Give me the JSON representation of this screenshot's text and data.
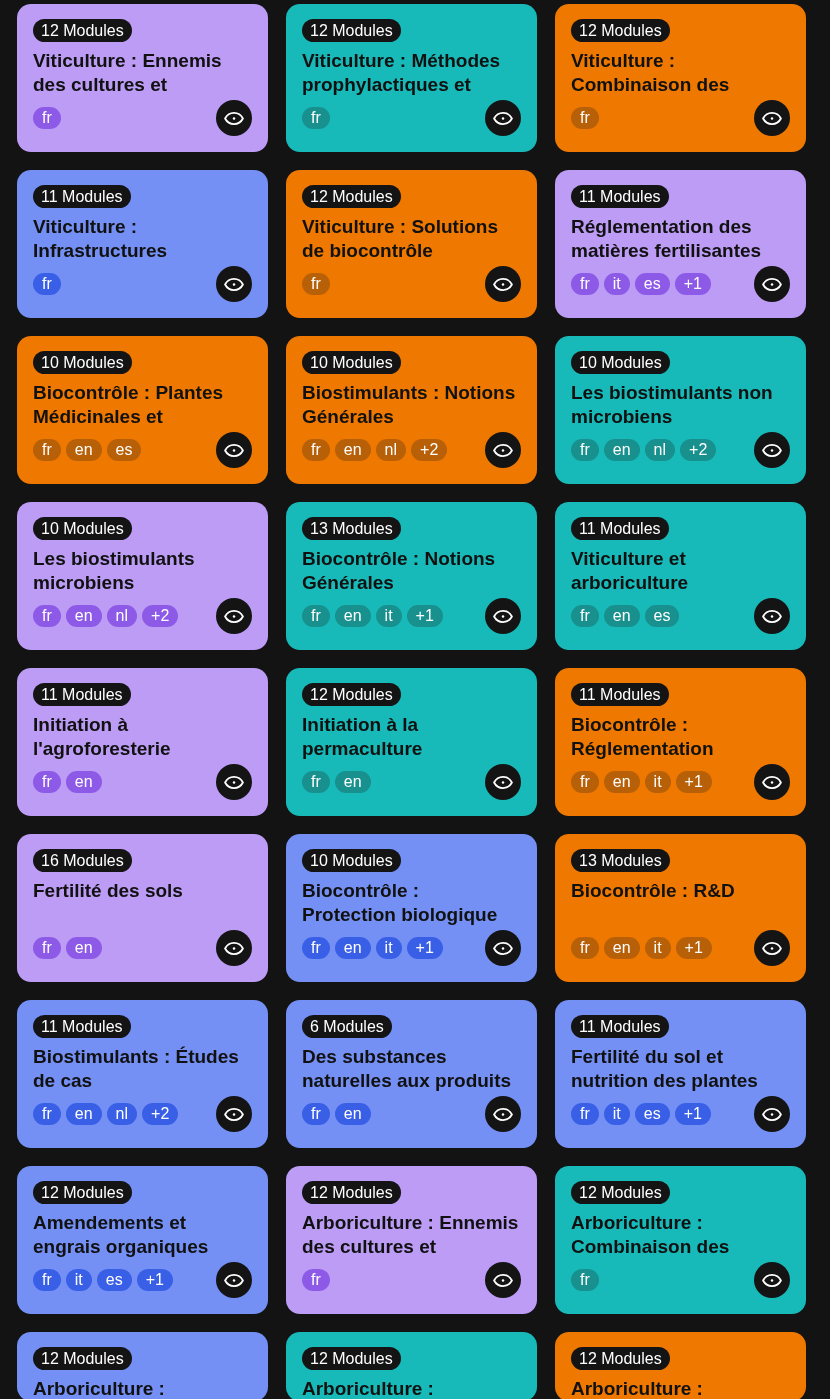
{
  "cards": [
    {
      "kind": "full",
      "modules": "12 Modules",
      "title": "Viticulture : Ennemis\ndes cultures et",
      "color": "#bc9cf5",
      "languages": [
        "fr"
      ]
    },
    {
      "kind": "full",
      "modules": "12 Modules",
      "title": "Viticulture : Méthodes\nprophylactiques et",
      "color": "#17bab8",
      "languages": [
        "fr"
      ]
    },
    {
      "kind": "full",
      "modules": "12 Modules",
      "title": "Viticulture :\nCombinaison des",
      "color": "#ef7800",
      "languages": [
        "fr"
      ]
    },
    {
      "kind": "full",
      "modules": "11 Modules",
      "title": "Viticulture :\nInfrastructures",
      "color": "#7490f4",
      "languages": [
        "fr"
      ]
    },
    {
      "kind": "full",
      "modules": "12 Modules",
      "title": "Viticulture : Solutions\nde biocontrôle",
      "color": "#ef7800",
      "languages": [
        "fr"
      ]
    },
    {
      "kind": "full",
      "modules": "11 Modules",
      "title": "Réglementation des\nmatières fertilisantes",
      "color": "#bc9cf5",
      "languages": [
        "fr",
        "it",
        "es"
      ],
      "more": "+1"
    },
    {
      "kind": "full",
      "modules": "10 Modules",
      "title": "Biocontrôle : Plantes\nMédicinales et",
      "color": "#ef7800",
      "languages": [
        "fr",
        "en",
        "es"
      ]
    },
    {
      "kind": "full",
      "modules": "10 Modules",
      "title": "Biostimulants : Notions\nGénérales",
      "color": "#ef7800",
      "languages": [
        "fr",
        "en",
        "nl"
      ],
      "more": "+2"
    },
    {
      "kind": "full",
      "modules": "10 Modules",
      "title": "Les biostimulants non\nmicrobiens",
      "color": "#17bab8",
      "languages": [
        "fr",
        "en",
        "nl"
      ],
      "more": "+2"
    },
    {
      "kind": "full",
      "modules": "10 Modules",
      "title": "Les biostimulants\nmicrobiens",
      "color": "#bc9cf5",
      "languages": [
        "fr",
        "en",
        "nl"
      ],
      "more": "+2"
    },
    {
      "kind": "full",
      "modules": "13 Modules",
      "title": "Biocontrôle : Notions\nGénérales",
      "color": "#17bab8",
      "languages": [
        "fr",
        "en",
        "it"
      ],
      "more": "+1"
    },
    {
      "kind": "full",
      "modules": "11 Modules",
      "title": "Viticulture et\narboriculture",
      "color": "#17bab8",
      "languages": [
        "fr",
        "en",
        "es"
      ]
    },
    {
      "kind": "full",
      "modules": "11 Modules",
      "title": "Initiation à\nl'agroforesterie",
      "color": "#bc9cf5",
      "languages": [
        "fr",
        "en"
      ]
    },
    {
      "kind": "full",
      "modules": "12 Modules",
      "title": "Initiation à la\npermaculture",
      "color": "#17bab8",
      "languages": [
        "fr",
        "en"
      ]
    },
    {
      "kind": "full",
      "modules": "11 Modules",
      "title": "Biocontrôle :\nRéglementation",
      "color": "#ef7800",
      "languages": [
        "fr",
        "en",
        "it"
      ],
      "more": "+1"
    },
    {
      "kind": "full",
      "modules": "16 Modules",
      "title": "Fertilité des sols",
      "color": "#bc9cf5",
      "languages": [
        "fr",
        "en"
      ]
    },
    {
      "kind": "full",
      "modules": "10 Modules",
      "title": "Biocontrôle :\nProtection biologique",
      "color": "#7490f4",
      "languages": [
        "fr",
        "en",
        "it"
      ],
      "more": "+1"
    },
    {
      "kind": "full",
      "modules": "13 Modules",
      "title": "Biocontrôle : R&D",
      "color": "#ef7800",
      "languages": [
        "fr",
        "en",
        "it"
      ],
      "more": "+1"
    },
    {
      "kind": "full",
      "modules": "11 Modules",
      "title": "Biostimulants : Études\nde cas",
      "color": "#7490f4",
      "languages": [
        "fr",
        "en",
        "nl"
      ],
      "more": "+2"
    },
    {
      "kind": "full",
      "modules": "6 Modules",
      "title": "Des substances\nnaturelles aux produits",
      "color": "#7490f4",
      "languages": [
        "fr",
        "en"
      ]
    },
    {
      "kind": "full",
      "modules": "11 Modules",
      "title": "Fertilité du sol et\nnutrition des plantes",
      "color": "#7490f4",
      "languages": [
        "fr",
        "it",
        "es"
      ],
      "more": "+1"
    },
    {
      "kind": "full",
      "modules": "12 Modules",
      "title": "Amendements et\nengrais organiques",
      "color": "#7490f4",
      "languages": [
        "fr",
        "it",
        "es"
      ],
      "more": "+1"
    },
    {
      "kind": "full",
      "modules": "12 Modules",
      "title": "Arboriculture : Ennemis\ndes cultures et",
      "color": "#bc9cf5",
      "languages": [
        "fr"
      ]
    },
    {
      "kind": "full",
      "modules": "12 Modules",
      "title": "Arboriculture :\nCombinaison des",
      "color": "#17bab8",
      "languages": [
        "fr"
      ]
    },
    {
      "kind": "cut",
      "modules": "12 Modules",
      "title": "Arboriculture :",
      "color": "#7490f4"
    },
    {
      "kind": "cut",
      "modules": "12 Modules",
      "title": "Arboriculture :",
      "color": "#17bab8"
    },
    {
      "kind": "cut",
      "modules": "12 Modules",
      "title": "Arboriculture :",
      "color": "#ef7800"
    }
  ]
}
